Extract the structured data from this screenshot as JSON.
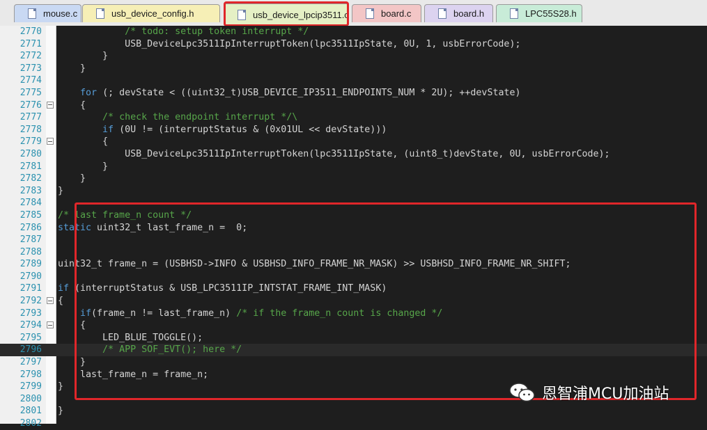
{
  "tabs": [
    {
      "label": "mouse.c",
      "color": "#c9d9f3",
      "active": false
    },
    {
      "label": "usb_device_config.h",
      "color": "#f6efb6",
      "active": false
    },
    {
      "label": "usb_device_lpcip3511.c",
      "color": "#e5f0c5",
      "active": true
    },
    {
      "label": "board.c",
      "color": "#f3c6c6",
      "active": false
    },
    {
      "label": "board.h",
      "color": "#dcd3f0",
      "active": false
    },
    {
      "label": "LPC55S28.h",
      "color": "#c8ecd8",
      "active": false
    }
  ],
  "lines": [
    {
      "no": "2770",
      "text": "            /* todo: setup token interrupt */"
    },
    {
      "no": "2771",
      "text": "            USB_DeviceLpc3511IpInterruptToken(lpc3511IpState, 0U, 1, usbErrorCode);"
    },
    {
      "no": "2772",
      "text": "        }"
    },
    {
      "no": "2773",
      "text": "    }"
    },
    {
      "no": "2774",
      "text": ""
    },
    {
      "no": "2775",
      "text": "    for (; devState < ((uint32_t)USB_DEVICE_IP3511_ENDPOINTS_NUM * 2U); ++devState)"
    },
    {
      "no": "2776",
      "text": "    {",
      "fold": true
    },
    {
      "no": "2777",
      "text": "        /* check the endpoint interrupt */\\"
    },
    {
      "no": "2778",
      "text": "        if (0U != (interruptStatus & (0x01UL << devState)))"
    },
    {
      "no": "2779",
      "text": "        {",
      "fold": true
    },
    {
      "no": "2780",
      "text": "            USB_DeviceLpc3511IpInterruptToken(lpc3511IpState, (uint8_t)devState, 0U, usbErrorCode);"
    },
    {
      "no": "2781",
      "text": "        }"
    },
    {
      "no": "2782",
      "text": "    }"
    },
    {
      "no": "2783",
      "text": "}"
    },
    {
      "no": "2784",
      "text": ""
    },
    {
      "no": "2785",
      "text": "/* last frame_n count */"
    },
    {
      "no": "2786",
      "text": "static uint32_t last_frame_n =  0;"
    },
    {
      "no": "2787",
      "text": ""
    },
    {
      "no": "2788",
      "text": ""
    },
    {
      "no": "2789",
      "text": "uint32_t frame_n = (USBHSD->INFO & USBHSD_INFO_FRAME_NR_MASK) >> USBHSD_INFO_FRAME_NR_SHIFT;"
    },
    {
      "no": "2790",
      "text": ""
    },
    {
      "no": "2791",
      "text": "if (interruptStatus & USB_LPC3511IP_INTSTAT_FRAME_INT_MASK)"
    },
    {
      "no": "2792",
      "text": "{",
      "fold": true
    },
    {
      "no": "2793",
      "text": "    if(frame_n != last_frame_n) /* if the frame_n count is changed */"
    },
    {
      "no": "2794",
      "text": "    {",
      "fold": true
    },
    {
      "no": "2795",
      "text": "        LED_BLUE_TOGGLE();"
    },
    {
      "no": "2796",
      "text": "        /* APP SOF_EVT(); here */",
      "current": true
    },
    {
      "no": "2797",
      "text": "    }"
    },
    {
      "no": "2798",
      "text": "    last_frame_n = frame_n;"
    },
    {
      "no": "2799",
      "text": "}"
    },
    {
      "no": "2800",
      "text": ""
    },
    {
      "no": "2801",
      "text": "}"
    },
    {
      "no": "2802",
      "text": ""
    }
  ],
  "watermark": {
    "text": "恩智浦MCU加油站",
    "icon": "wechat-icon"
  },
  "colors": {
    "highlight": "#e0262a",
    "keyword": "#569cd6",
    "comment": "#57a64a",
    "line_number": "#2b91af"
  }
}
